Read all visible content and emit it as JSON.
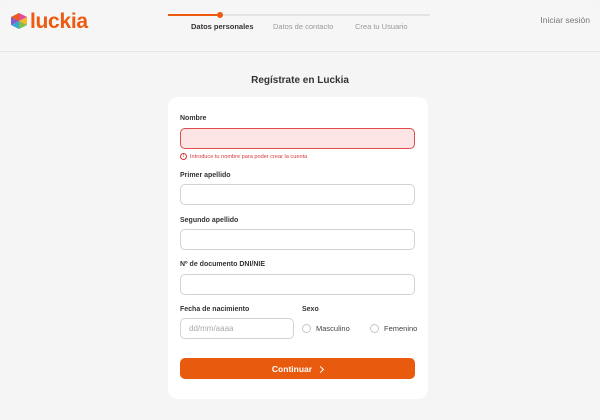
{
  "header": {
    "brand": "luckia",
    "login_label": "Iniciar sesión",
    "steps": [
      "Datos personales",
      "Datos de contacto",
      "Crea tu Usuario"
    ],
    "active_step": 1,
    "progress": 0.2
  },
  "form": {
    "title": "Regístrate en Luckia",
    "nombre_label": "Nombre",
    "nombre_value": "",
    "nombre_error": "Introduce tu nombre para poder crear la cuenta",
    "apellido1_label": "Primer apellido",
    "apellido1_value": "",
    "apellido2_label": "Segundo apellido",
    "apellido2_value": "",
    "documento_label": "Nº de documento DNI/NIE",
    "documento_value": "",
    "fecha_label": "Fecha de nacimiento",
    "fecha_placeholder": "dd/mm/aaaa",
    "sexo_label": "Sexo",
    "sexo_options": [
      "Masculino",
      "Femenino"
    ],
    "submit_label": "Continuar"
  },
  "colors": {
    "brand": "#ee5a0f",
    "button": "#e85a0d",
    "error": "#d23a3a",
    "error_bg": "#fde5e5",
    "background": "#f5f5f5"
  },
  "icons": {
    "logo": "luckia-logo-icon",
    "error": "error-circle-icon",
    "submit": "chevron-right-icon"
  }
}
